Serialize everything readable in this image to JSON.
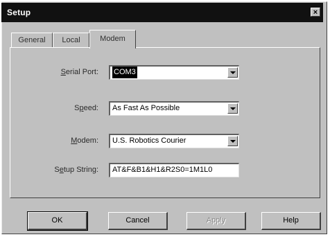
{
  "window": {
    "title": "Setup",
    "close_label": "×"
  },
  "tabs": [
    {
      "label": "General",
      "active": false
    },
    {
      "label": "Local",
      "active": false
    },
    {
      "label": "Modem",
      "active": true
    }
  ],
  "form": {
    "serial_port": {
      "label_pre": "",
      "label_ul": "S",
      "label_post": "erial Port:",
      "value": "COM3"
    },
    "speed": {
      "label_pre": "S",
      "label_ul": "p",
      "label_post": "eed:",
      "value": "As Fast As Possible"
    },
    "modem": {
      "label_pre": "",
      "label_ul": "M",
      "label_post": "odem:",
      "value": "U.S. Robotics Courier"
    },
    "setup_string": {
      "label_pre": "S",
      "label_ul": "e",
      "label_post": "tup String:",
      "value": "AT&F&B1&H1&R2S0=1M1L0"
    }
  },
  "buttons": {
    "ok": "OK",
    "cancel": "Cancel",
    "apply": "Apply",
    "help": "Help"
  }
}
